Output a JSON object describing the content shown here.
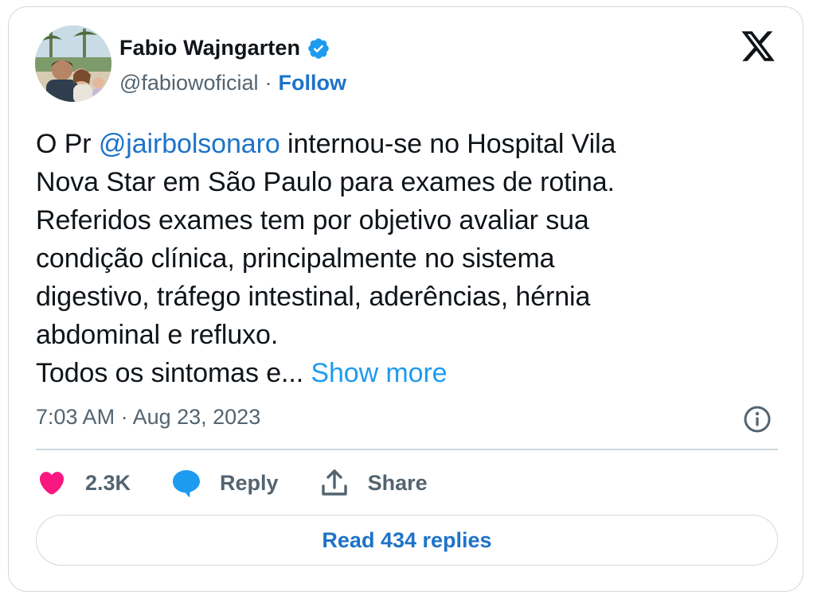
{
  "author": {
    "display_name": "Fabio Wajngarten",
    "handle": "@fabiowoficial",
    "separator": "·",
    "follow_label": "Follow",
    "verified_icon": "verified-badge-icon",
    "verified_color": "#1d9bf0"
  },
  "tweet": {
    "segments": {
      "prefix": "O Pr ",
      "mention": "@jairbolsonaro",
      "line1_rest": " internou-se no Hospital Vila",
      "line2": "Nova Star em São Paulo para exames de rotina.",
      "line3": "Referidos exames tem por objetivo avaliar sua",
      "line4": "condição clínica, principalmente no sistema",
      "line5": "digestivo, tráfego intestinal, aderências, hérnia",
      "line6": "abdominal e refluxo.",
      "line7": "Todos os sintomas e... "
    },
    "show_more_label": "Show more",
    "timestamp": "7:03 AM · Aug 23, 2023"
  },
  "actions": {
    "likes": {
      "icon": "heart-icon",
      "count": "2.3K",
      "color": "#f91880"
    },
    "reply": {
      "icon": "reply-bubble-icon",
      "label": "Reply",
      "color": "#1d9bf0"
    },
    "share": {
      "icon": "share-upload-icon",
      "label": "Share"
    }
  },
  "read_replies_label": "Read 434 replies",
  "colors": {
    "link": "#1d73c9",
    "secondary_text": "#536471",
    "border": "#cfd9de"
  }
}
